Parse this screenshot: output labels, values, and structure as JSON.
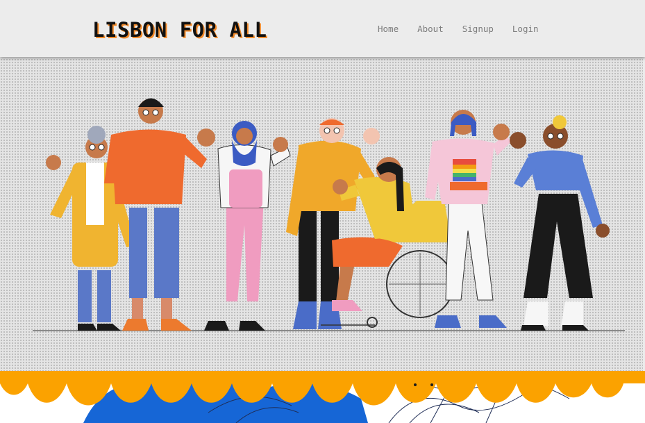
{
  "brand": {
    "title": "LISBON FOR ALL"
  },
  "nav": {
    "home": "Home",
    "about": "About",
    "signup": "Signup",
    "login": "Login"
  },
  "hero": {
    "image": "illustration-diverse-people-waving",
    "people": [
      "elderly-person",
      "man-beanie",
      "woman-hijab",
      "man-yellow-hoodie",
      "woman-wheelchair",
      "person-rainbow-shirt",
      "woman-blue-top"
    ]
  },
  "footer_band": {
    "image": "wavy-orange-blue-pattern"
  },
  "colors": {
    "header_bg": "#ececec",
    "brand_shadow": "#f28a2a",
    "nav_text": "#7d7d7d",
    "orange": "#fba200",
    "blue": "#1666d6"
  }
}
